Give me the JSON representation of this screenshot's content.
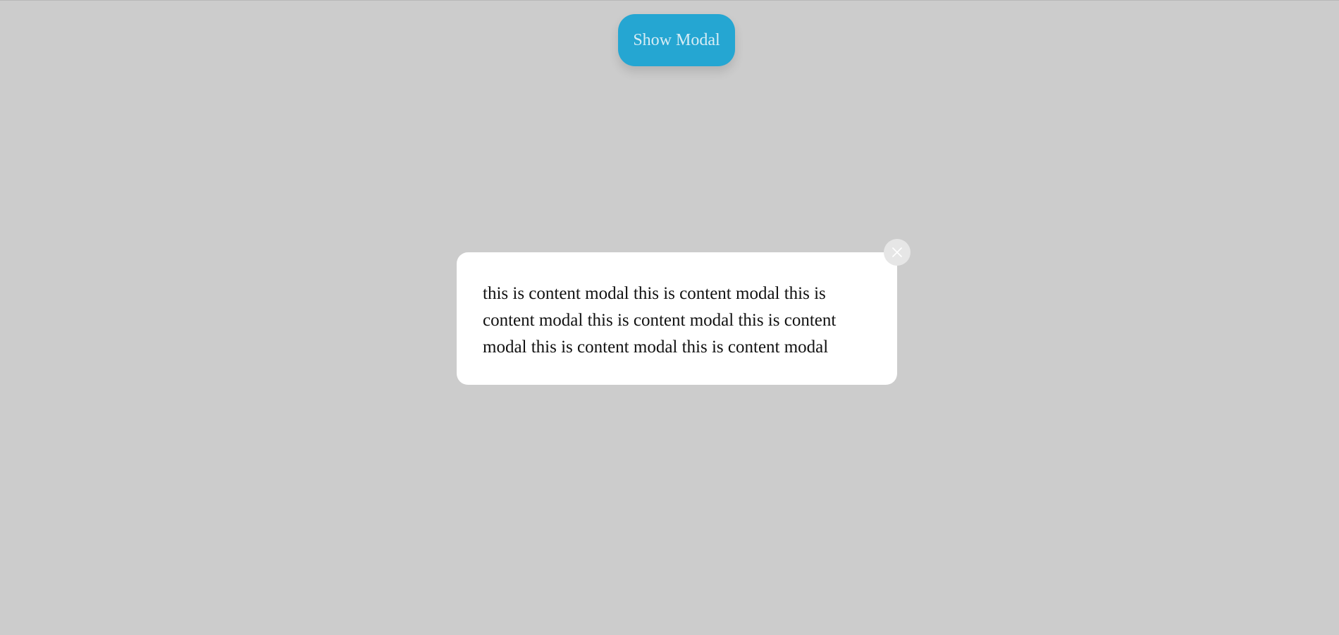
{
  "header": {
    "show_modal_label": "Show Modal"
  },
  "modal": {
    "content": "this is content modal this is content modal this is content modal this is content modal this is content modal this is content modal this is content modal",
    "close_icon": "close-icon"
  },
  "colors": {
    "background": "#cccccc",
    "button": "#25a6d2",
    "button_text": "#d8edf5",
    "modal_background": "#ffffff",
    "close_button_background": "#e6e6e6"
  }
}
